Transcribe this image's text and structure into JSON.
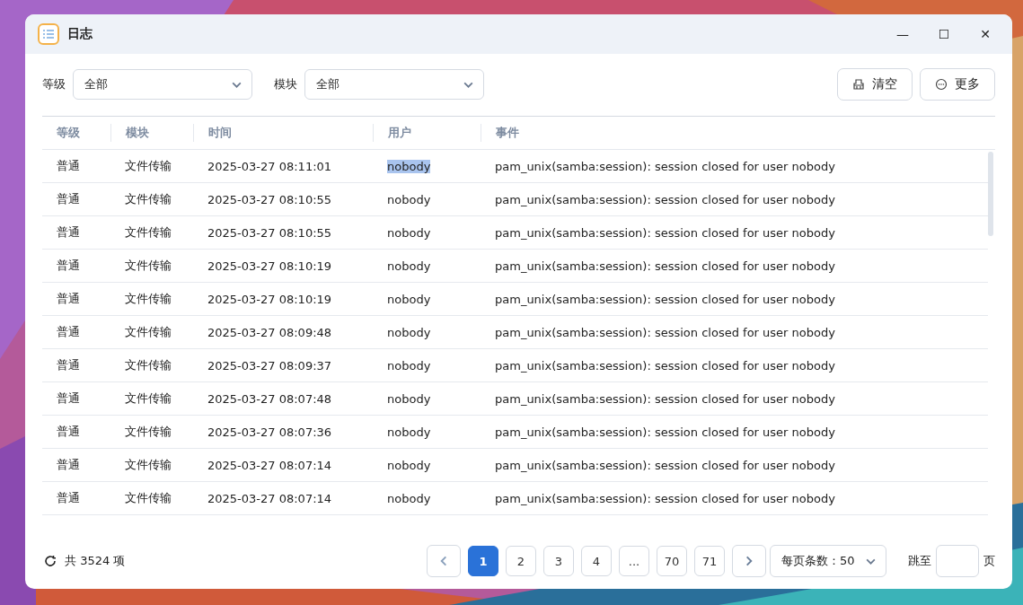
{
  "window": {
    "title": "日志",
    "controls": [
      "—",
      "☐",
      "✕"
    ]
  },
  "filters": [
    {
      "label": "等级",
      "value": "全部"
    },
    {
      "label": "模块",
      "value": "全部"
    }
  ],
  "actions": [
    {
      "kind": "clear",
      "label": "清空"
    },
    {
      "kind": "more",
      "label": "更多"
    }
  ],
  "table": {
    "columns": [
      "等级",
      "模块",
      "时间",
      "用户",
      "事件"
    ],
    "rows": [
      {
        "cells": [
          "普通",
          "文件传输",
          "2025-03-27 08:11:01",
          "nobody",
          "pam_unix(samba:session): session closed for user nobody"
        ],
        "user_highlighted": true
      },
      {
        "cells": [
          "普通",
          "文件传输",
          "2025-03-27 08:10:55",
          "nobody",
          "pam_unix(samba:session): session closed for user nobody"
        ],
        "user_highlighted": false
      },
      {
        "cells": [
          "普通",
          "文件传输",
          "2025-03-27 08:10:55",
          "nobody",
          "pam_unix(samba:session): session closed for user nobody"
        ],
        "user_highlighted": false
      },
      {
        "cells": [
          "普通",
          "文件传输",
          "2025-03-27 08:10:19",
          "nobody",
          "pam_unix(samba:session): session closed for user nobody"
        ],
        "user_highlighted": false
      },
      {
        "cells": [
          "普通",
          "文件传输",
          "2025-03-27 08:10:19",
          "nobody",
          "pam_unix(samba:session): session closed for user nobody"
        ],
        "user_highlighted": false
      },
      {
        "cells": [
          "普通",
          "文件传输",
          "2025-03-27 08:09:48",
          "nobody",
          "pam_unix(samba:session): session closed for user nobody"
        ],
        "user_highlighted": false
      },
      {
        "cells": [
          "普通",
          "文件传输",
          "2025-03-27 08:09:37",
          "nobody",
          "pam_unix(samba:session): session closed for user nobody"
        ],
        "user_highlighted": false
      },
      {
        "cells": [
          "普通",
          "文件传输",
          "2025-03-27 08:07:48",
          "nobody",
          "pam_unix(samba:session): session closed for user nobody"
        ],
        "user_highlighted": false
      },
      {
        "cells": [
          "普通",
          "文件传输",
          "2025-03-27 08:07:36",
          "nobody",
          "pam_unix(samba:session): session closed for user nobody"
        ],
        "user_highlighted": false
      },
      {
        "cells": [
          "普通",
          "文件传输",
          "2025-03-27 08:07:14",
          "nobody",
          "pam_unix(samba:session): session closed for user nobody"
        ],
        "user_highlighted": false
      },
      {
        "cells": [
          "普通",
          "文件传输",
          "2025-03-27 08:07:14",
          "nobody",
          "pam_unix(samba:session): session closed for user nobody"
        ],
        "user_highlighted": false
      }
    ]
  },
  "footer": {
    "total": "共 3524 项",
    "pages": [
      {
        "label": "1",
        "selected": true
      },
      {
        "label": "2",
        "selected": false
      },
      {
        "label": "3",
        "selected": false
      },
      {
        "label": "4",
        "selected": false
      },
      {
        "label": "...",
        "selected": false
      },
      {
        "label": "70",
        "selected": false
      },
      {
        "label": "71",
        "selected": false
      }
    ],
    "page_size": "每页条数：50",
    "jump_label": "跳至",
    "jump_suffix": "页"
  }
}
